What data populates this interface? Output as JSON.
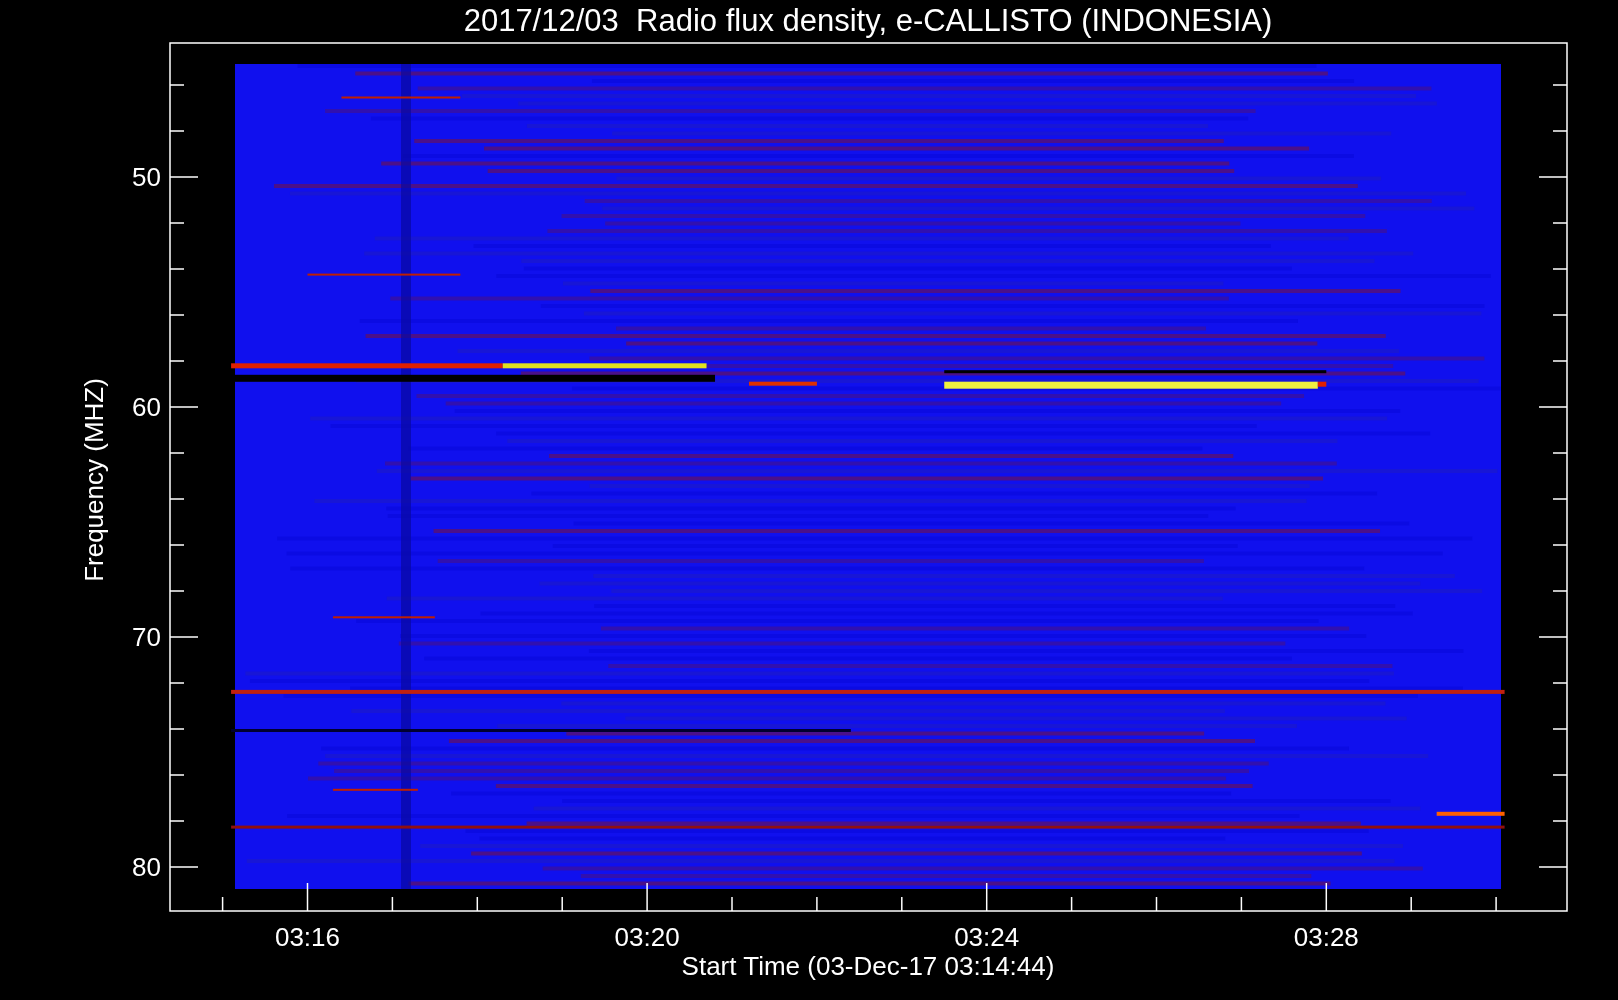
{
  "title": "2017/12/03  Radio flux density, e-CALLISTO (INDONESIA)",
  "plot": {
    "ylabel": "Frequency (MHZ)",
    "xlabel": "Start Time (03-Dec-17 03:14:44)",
    "yticks": [
      {
        "label": "50"
      },
      {
        "label": "60"
      },
      {
        "label": "70"
      },
      {
        "label": "80"
      }
    ],
    "xticks": [
      {
        "label": "03:16"
      },
      {
        "label": "03:20"
      },
      {
        "label": "03:24"
      },
      {
        "label": "03:28"
      }
    ]
  }
}
